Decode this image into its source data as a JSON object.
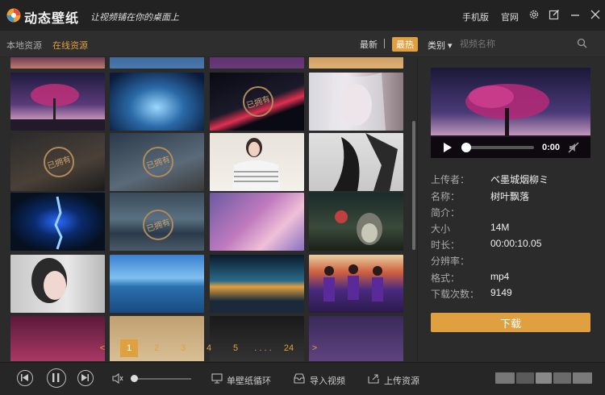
{
  "titlebar": {
    "app_name": "动态壁纸",
    "slogan": "让视频铺在你的桌面上",
    "mobile_label": "手机版",
    "website_label": "官网"
  },
  "tabs": {
    "local": "本地资源",
    "online": "在线资源"
  },
  "sort": {
    "newest": "最新",
    "hottest": "最热"
  },
  "search": {
    "category_label": "类别 ▾",
    "placeholder": "视频名称"
  },
  "watermark_text": "已拥有",
  "pagination": {
    "prev": "<",
    "pages": [
      "1",
      "2",
      "3",
      "4",
      "5"
    ],
    "ellipsis": ". . . .",
    "last": "24",
    "next": ">",
    "current": "1"
  },
  "player": {
    "time": "0:00",
    "progress_fraction": 0.05
  },
  "details": {
    "uploader_label": "上传者：",
    "uploader_value": "ベ墨城烟柳ミ",
    "name_label": "名称：",
    "name_value": "树叶飘落",
    "intro_label": "简介：",
    "size_label": "大小",
    "size_value": "14M",
    "duration_label": "时长：",
    "duration_value": "00:00:10.05",
    "resolution_label": "分辨率：",
    "format_label": "格式：",
    "format_value": "mp4",
    "downloads_label": "下载次数：",
    "downloads_value": "9149"
  },
  "download_button": "下载",
  "bottombar": {
    "loop_label": "单壁纸循环",
    "import_label": "导入视频",
    "upload_label": "上传资源",
    "volume_fraction": 0.05
  },
  "colors": {
    "accent": "#e0a040",
    "background": "#2b2b2b",
    "titlebar": "#222222"
  }
}
